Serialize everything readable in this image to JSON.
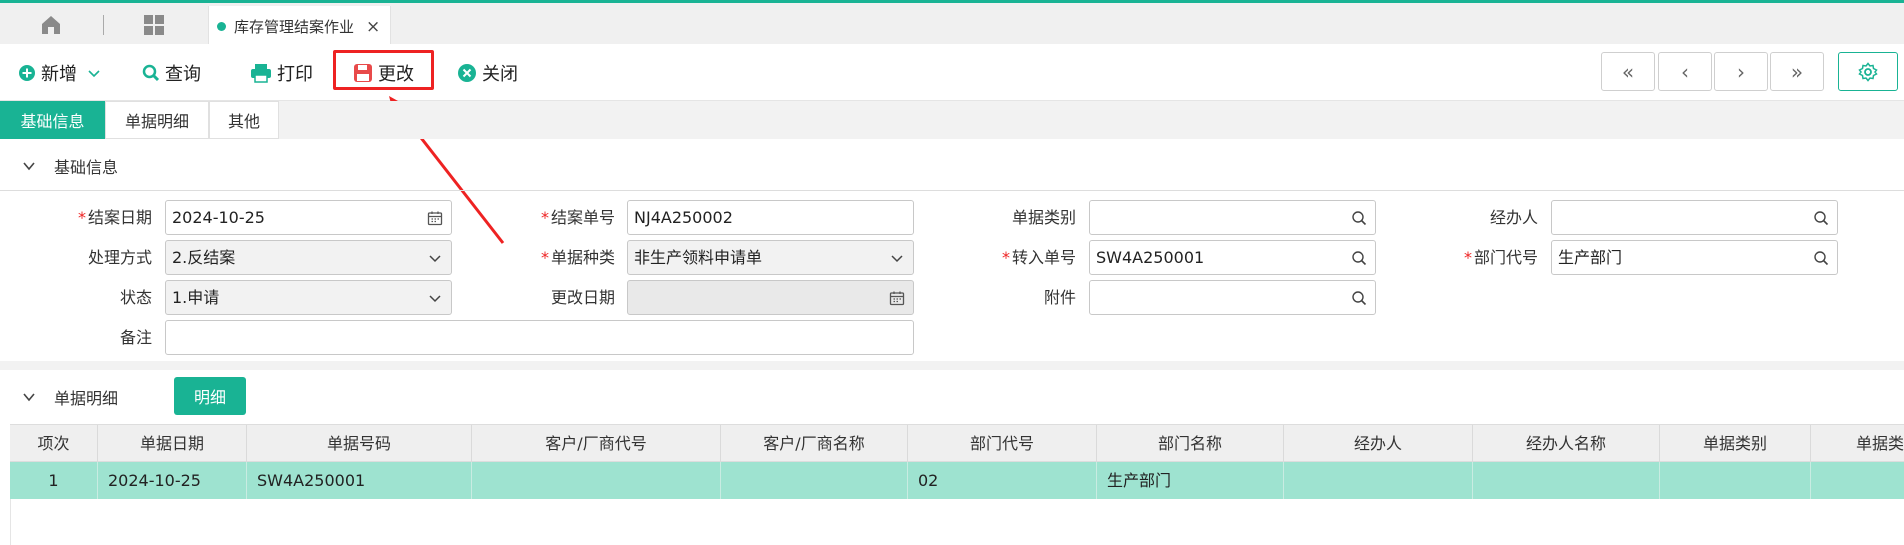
{
  "tabs": {
    "active_label": "库存管理结案作业",
    "close": "×"
  },
  "toolbar": {
    "add": "新增",
    "query": "查询",
    "print": "打印",
    "edit": "更改",
    "close": "关闭",
    "nav": [
      "«",
      "‹",
      "›",
      "»"
    ]
  },
  "subtabs": [
    "基础信息",
    "单据明细",
    "其他"
  ],
  "section_basic": "基础信息",
  "form": {
    "close_date_label": "结案日期",
    "close_date": "2024-10-25",
    "close_no_label": "结案单号",
    "close_no": "NJ4A250002",
    "doc_type_label": "单据类别",
    "doc_type": "",
    "handler_label": "经办人",
    "handler": "",
    "method_label": "处理方式",
    "method": "2.反结案",
    "doc_kind_label": "单据种类",
    "doc_kind": "非生产领料申请单",
    "transfer_no_label": "转入单号",
    "transfer_no": "SW4A250001",
    "dept_label": "部门代号",
    "dept": "生产部门",
    "status_label": "状态",
    "status": "1.申请",
    "edit_date_label": "更改日期",
    "edit_date": "",
    "attachment_label": "附件",
    "attachment": "",
    "remark_label": "备注",
    "remark": ""
  },
  "section_detail": "单据明细",
  "detail_button": "明细",
  "grid": {
    "headers": [
      "项次",
      "单据日期",
      "单据号码",
      "客户/厂商代号",
      "客户/厂商名称",
      "部门代号",
      "部门名称",
      "经办人",
      "经办人名称",
      "单据类别",
      "单据类"
    ],
    "rows": [
      [
        "1",
        "2024-10-25",
        "SW4A250001",
        "",
        "",
        "02",
        "生产部门",
        "",
        "",
        "",
        ""
      ]
    ]
  },
  "colors": {
    "accent": "#19b394",
    "highlight": "#ee2222",
    "row_selected": "#9ee3d0"
  }
}
